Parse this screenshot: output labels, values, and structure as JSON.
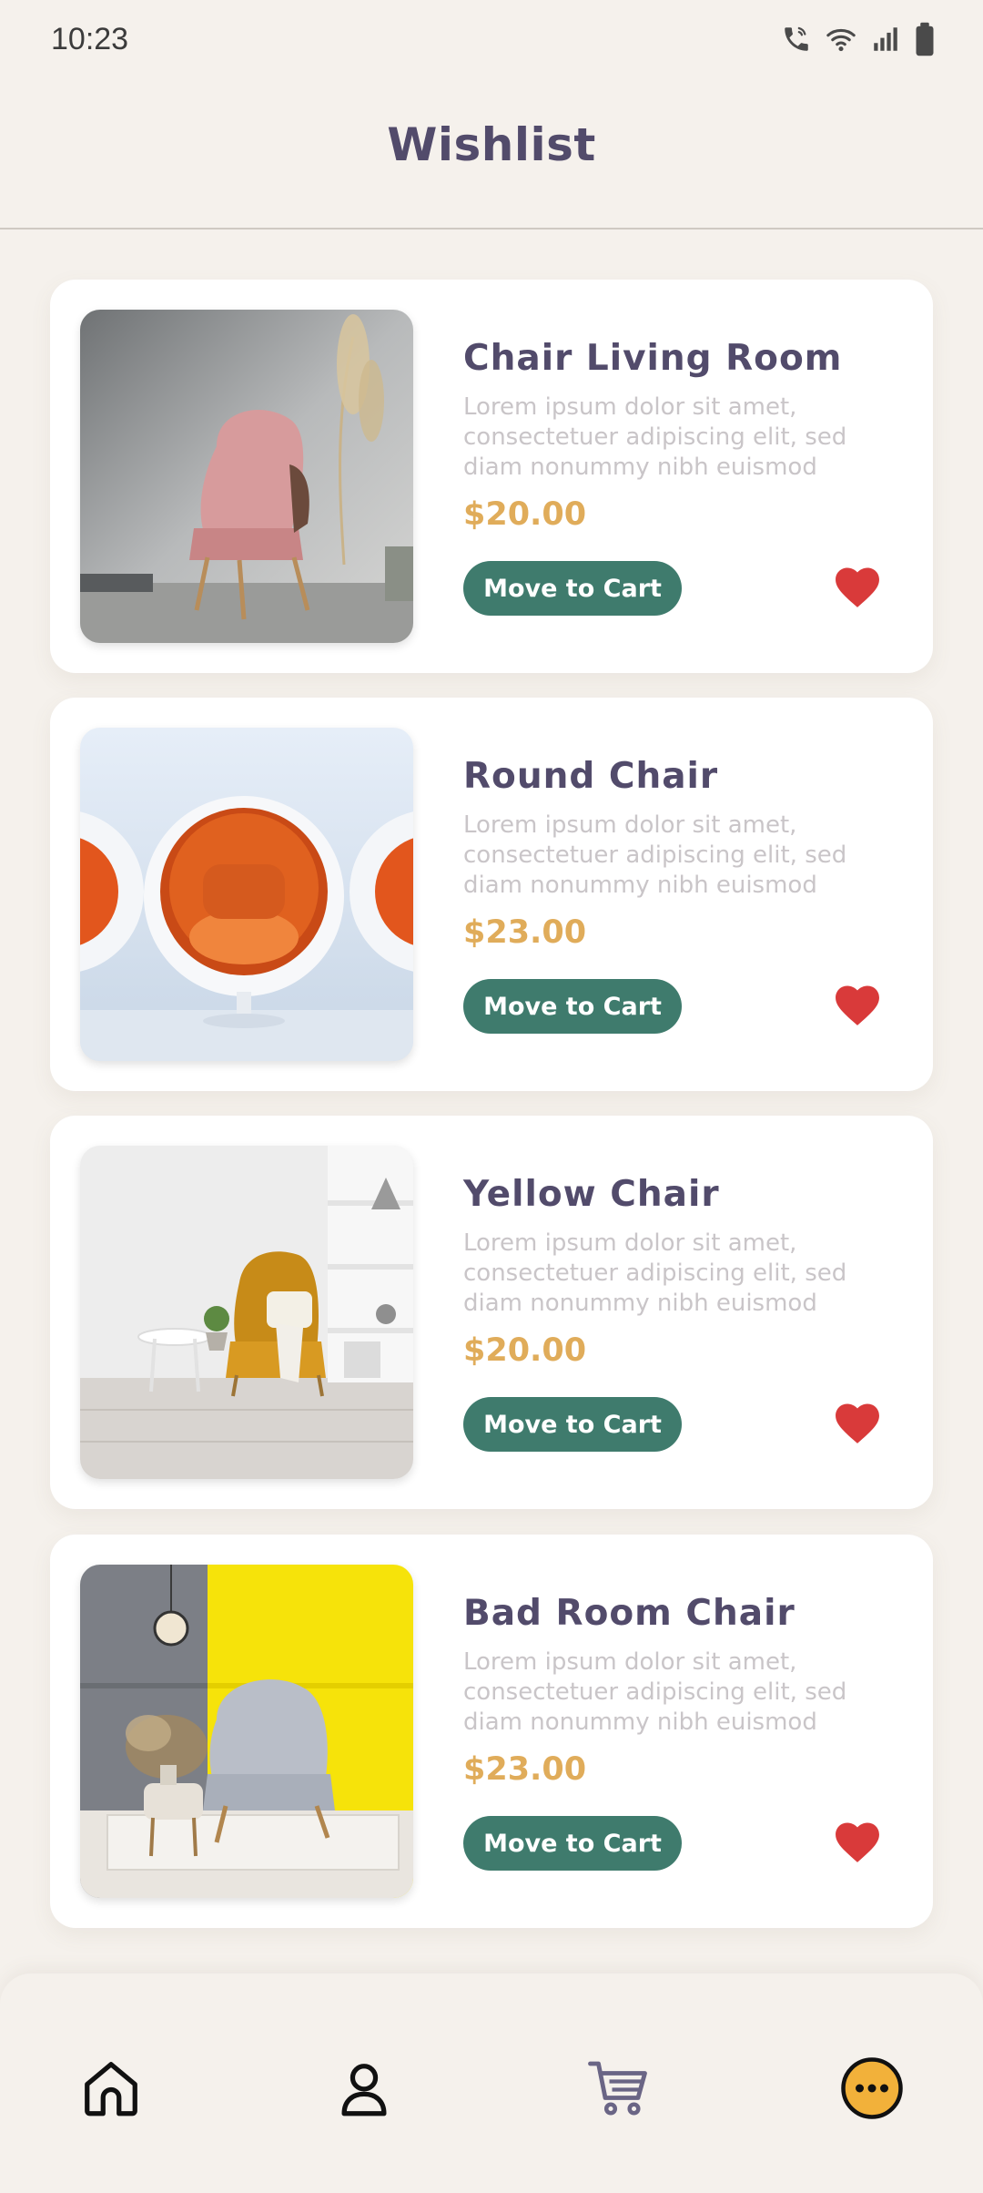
{
  "status_bar": {
    "time": "10:23",
    "icons": [
      "wifi-calling-icon",
      "wifi-icon",
      "signal-icon",
      "battery-icon"
    ]
  },
  "header": {
    "title": "Wishlist"
  },
  "wishlist": {
    "items": [
      {
        "title": "Chair Living Room",
        "description": "Lorem ipsum dolor sit amet, consectetuer adipiscing elit, sed diam nonummy nibh euismod",
        "price": "$20.00",
        "cart_label": "Move to Cart",
        "favorite": true
      },
      {
        "title": "Round Chair",
        "description": "Lorem ipsum dolor sit amet, consectetuer adipiscing elit, sed diam nonummy nibh euismod",
        "price": "$23.00",
        "cart_label": "Move to Cart",
        "favorite": true
      },
      {
        "title": "Yellow Chair",
        "description": "Lorem ipsum dolor sit amet, consectetuer adipiscing elit, sed diam nonummy nibh euismod",
        "price": "$20.00",
        "cart_label": "Move to Cart",
        "favorite": true
      },
      {
        "title": "Bad Room Chair",
        "description": "Lorem ipsum dolor sit amet, consectetuer adipiscing elit, sed diam nonummy nibh euismod",
        "price": "$23.00",
        "cart_label": "Move to Cart",
        "favorite": true
      }
    ]
  },
  "bottom_nav": {
    "items": [
      "home-icon",
      "profile-icon",
      "cart-icon",
      "more-icon"
    ],
    "active": "more-icon"
  },
  "colors": {
    "background": "#f5f1ec",
    "title": "#524b6b",
    "price": "#e0ac5a",
    "button": "#3f7b6d",
    "heart": "#d93a3a",
    "more_active": "#f2b13a"
  }
}
